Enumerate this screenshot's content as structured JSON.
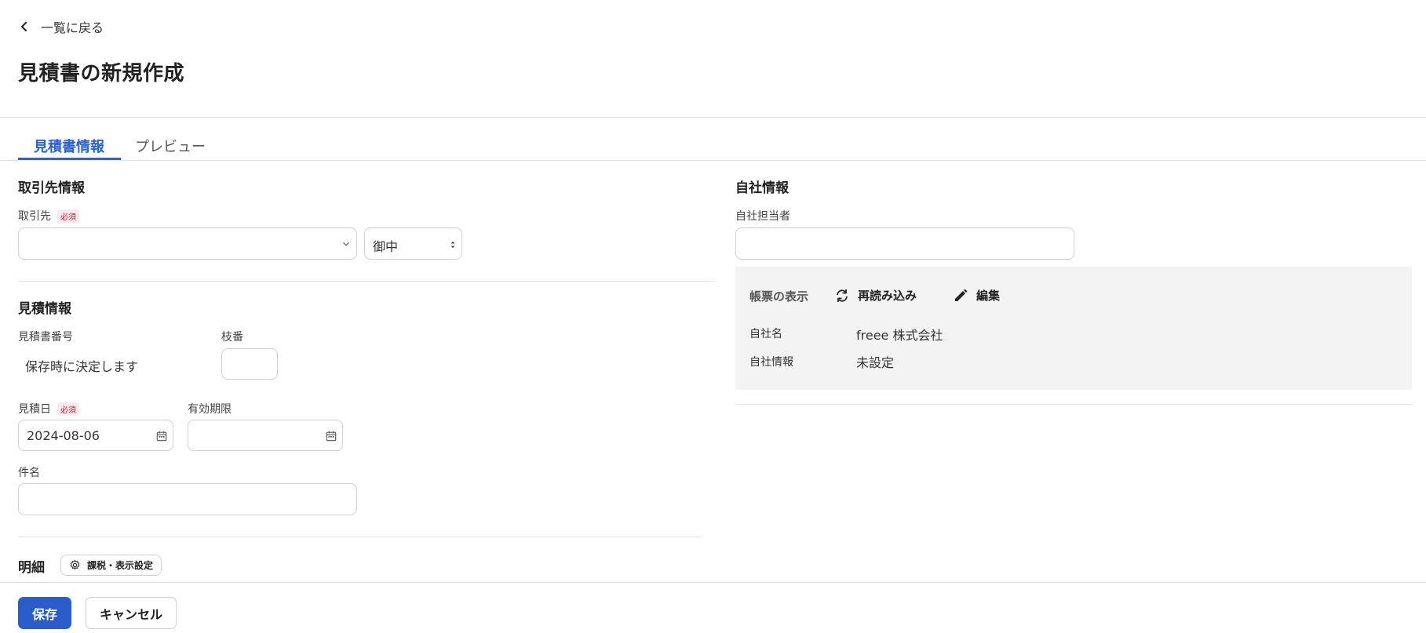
{
  "header": {
    "back_label": "一覧に戻る",
    "title": "見積書の新規作成"
  },
  "tabs": [
    {
      "label": "見積書情報",
      "active": true
    },
    {
      "label": "プレビュー",
      "active": false
    }
  ],
  "partner_section": {
    "title": "取引先情報",
    "partner_label": "取引先",
    "required_label": "必須",
    "partner_value": "",
    "honorific_value": "御中"
  },
  "quote_section": {
    "title": "見積情報",
    "number_label": "見積書番号",
    "number_value": "保存時に決定します",
    "branch_label": "枝番",
    "branch_value": "",
    "date_label": "見積日",
    "date_required": "必須",
    "date_value": "2024-08-06",
    "expiry_label": "有効期限",
    "expiry_value": "",
    "subject_label": "件名",
    "subject_value": ""
  },
  "details_section": {
    "title": "明細",
    "tax_settings_label": "課税・表示設定"
  },
  "company_section": {
    "title": "自社情報",
    "person_label": "自社担当者",
    "person_value": "",
    "display_label": "帳票の表示",
    "reload_label": "再読み込み",
    "edit_label": "編集",
    "company_name_label": "自社名",
    "company_name_value": "freee 株式会社",
    "company_info_label": "自社情報",
    "company_info_value": "未設定"
  },
  "footer": {
    "save_label": "保存",
    "cancel_label": "キャンセル"
  },
  "colors": {
    "accent": "#2864d9",
    "primary_button": "#2a5ccc",
    "required_text": "#c0223a",
    "panel_bg": "#f4f3f3"
  },
  "icons": [
    "chevron-left-icon",
    "chevron-down-icon",
    "select-arrows-icon",
    "calendar-icon",
    "refresh-icon",
    "pencil-icon",
    "gear-icon"
  ]
}
